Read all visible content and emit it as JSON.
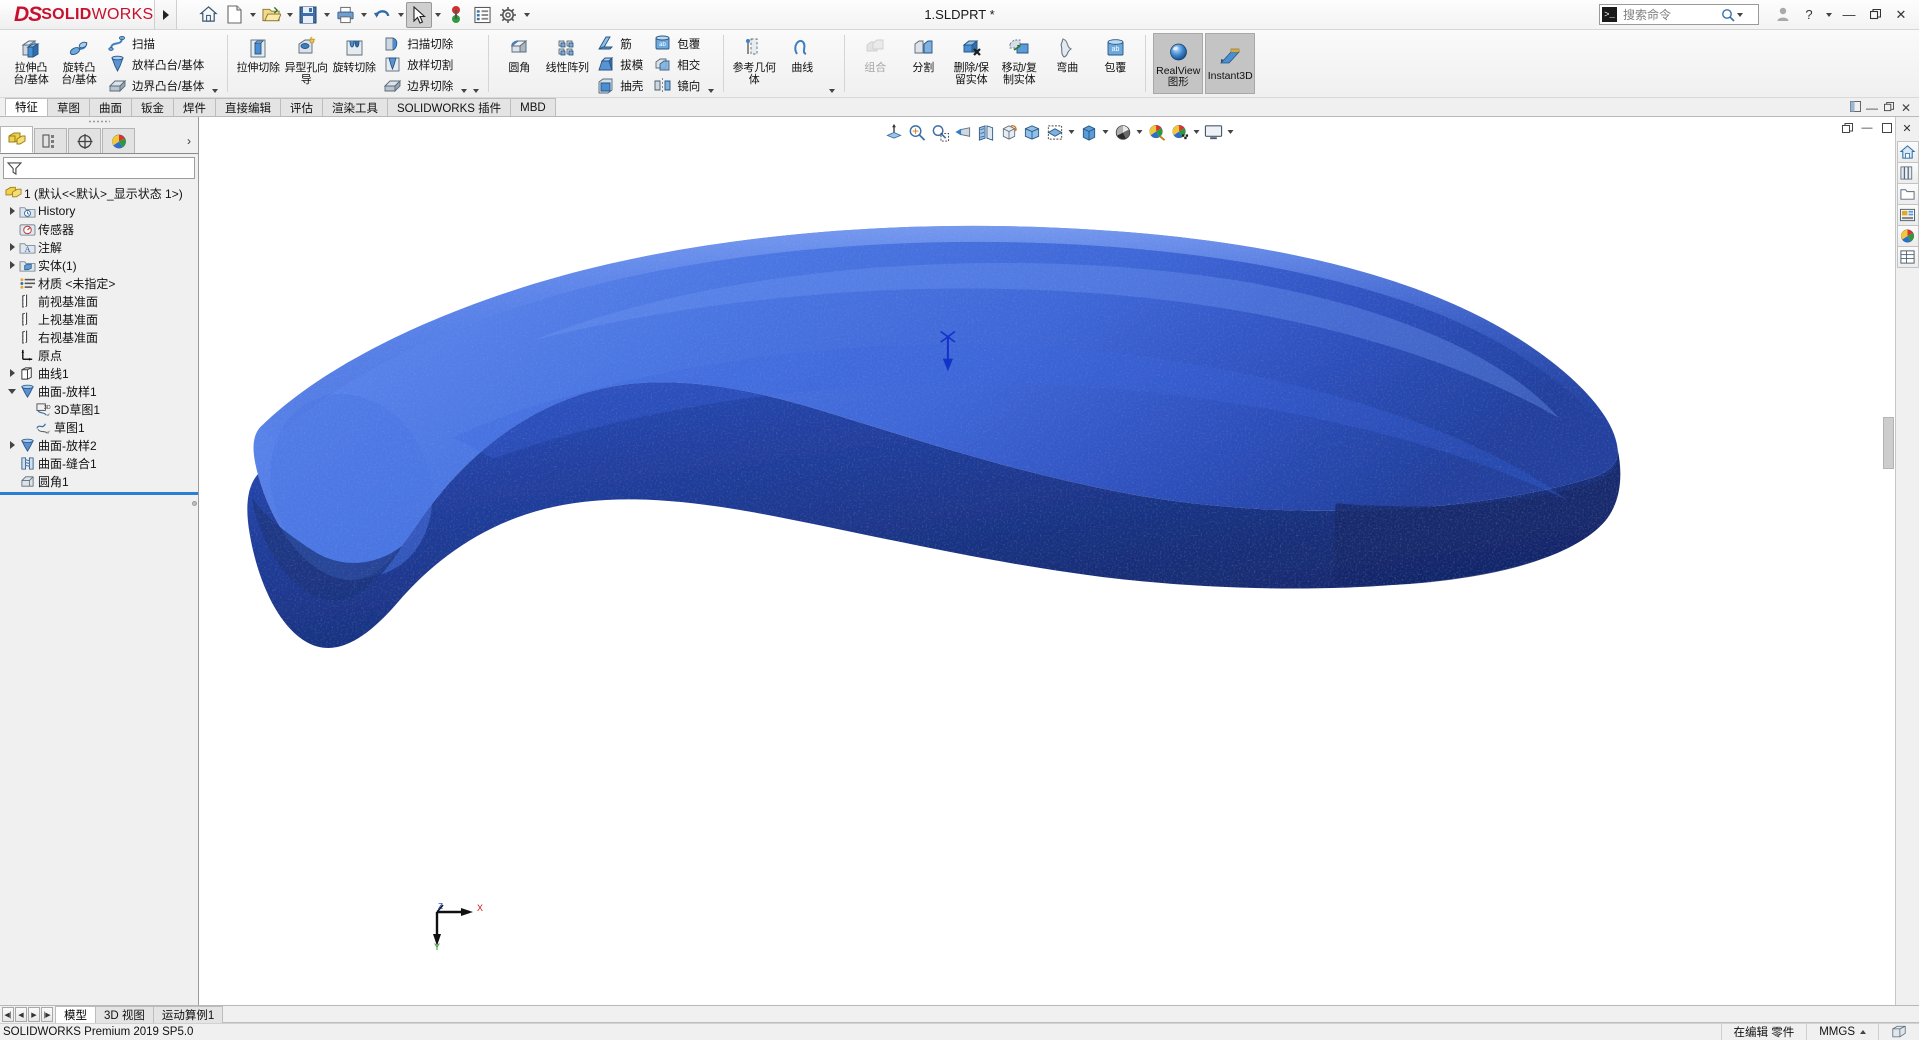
{
  "app": {
    "brand_ds": "DS",
    "brand_solid": "SOLID",
    "brand_works": "WORKS",
    "window_title": "1.SLDPRT *",
    "accent_color": "#c8102e",
    "model_color": "#3a62d8"
  },
  "titlebar": {
    "tools": [
      {
        "name": "home-icon",
        "label": "主页"
      },
      {
        "name": "new-document-icon",
        "label": "新建"
      },
      {
        "name": "open-folder-icon",
        "label": "打开"
      },
      {
        "name": "save-icon",
        "label": "保存"
      },
      {
        "name": "print-icon",
        "label": "打印"
      },
      {
        "name": "undo-icon",
        "label": "撤销"
      },
      {
        "name": "select-cursor-icon",
        "label": "选择"
      },
      {
        "name": "rebuild-icon",
        "label": "重建模型"
      },
      {
        "name": "options-list-icon",
        "label": "文件属性"
      },
      {
        "name": "gear-icon",
        "label": "选项"
      }
    ],
    "search": {
      "placeholder": "搜索命令",
      "value": ""
    },
    "user_label": "用户",
    "help_label": "?",
    "minimize": "—",
    "restore": "❐",
    "close": "✕"
  },
  "ribbon": {
    "groups": [
      {
        "name": "boss-base-group",
        "big": [
          {
            "label": "拉伸凸台/基体",
            "icon": "extrude-boss-icon"
          },
          {
            "label": "旋转凸台/基体",
            "icon": "revolve-boss-icon"
          }
        ],
        "small": [
          {
            "label": "扫描",
            "icon": "sweep-icon"
          },
          {
            "label": "放样凸台/基体",
            "icon": "loft-boss-icon"
          },
          {
            "label": "边界凸台/基体",
            "icon": "boundary-boss-icon"
          }
        ]
      },
      {
        "name": "cut-group",
        "big": [
          {
            "label": "拉伸切除",
            "icon": "extrude-cut-icon"
          },
          {
            "label": "异型孔向导",
            "icon": "hole-wizard-icon"
          },
          {
            "label": "旋转切除",
            "icon": "revolve-cut-icon"
          }
        ],
        "small": [
          {
            "label": "扫描切除",
            "icon": "sweep-cut-icon"
          },
          {
            "label": "放样切割",
            "icon": "loft-cut-icon"
          },
          {
            "label": "边界切除",
            "icon": "boundary-cut-icon"
          }
        ]
      },
      {
        "name": "feature-group",
        "big": [
          {
            "label": "圆角",
            "icon": "fillet-icon"
          },
          {
            "label": "线性阵列",
            "icon": "linear-pattern-icon"
          }
        ],
        "small": [
          {
            "label": "筋",
            "icon": "rib-icon"
          },
          {
            "label": "拔模",
            "icon": "draft-icon"
          },
          {
            "label": "抽壳",
            "icon": "shell-icon"
          },
          {
            "label": "包覆",
            "icon": "wrap-icon"
          },
          {
            "label": "相交",
            "icon": "intersect-icon"
          },
          {
            "label": "镜向",
            "icon": "mirror-icon"
          }
        ]
      },
      {
        "name": "reference-group",
        "big": [
          {
            "label": "参考几何体",
            "icon": "reference-geometry-icon"
          },
          {
            "label": "曲线",
            "icon": "curves-icon"
          }
        ]
      },
      {
        "name": "body-group",
        "big": [
          {
            "label": "组合",
            "icon": "combine-icon",
            "disabled": true
          },
          {
            "label": "分割",
            "icon": "split-icon"
          },
          {
            "label": "删除/保留实体",
            "icon": "delete-keep-body-icon"
          },
          {
            "label": "移动/复制实体",
            "icon": "move-copy-body-icon"
          },
          {
            "label": "弯曲",
            "icon": "flex-icon"
          },
          {
            "label": "包覆",
            "icon": "wrap-body-icon"
          }
        ]
      }
    ],
    "toggles": [
      {
        "label": "RealView 图形",
        "line1": "RealView",
        "line2": "图形",
        "icon": "realview-sphere-icon",
        "active": true
      },
      {
        "label": "Instant3D",
        "line1": "Instant3D",
        "line2": "",
        "icon": "instant3d-icon",
        "active": true
      }
    ]
  },
  "tabs": {
    "items": [
      {
        "label": "特征",
        "active": true
      },
      {
        "label": "草图",
        "active": false
      },
      {
        "label": "曲面",
        "active": false
      },
      {
        "label": "钣金",
        "active": false
      },
      {
        "label": "焊件",
        "active": false
      },
      {
        "label": "直接编辑",
        "active": false
      },
      {
        "label": "评估",
        "active": false
      },
      {
        "label": "渲染工具",
        "active": false
      },
      {
        "label": "SOLIDWORKS 插件",
        "active": false
      },
      {
        "label": "MBD",
        "active": false
      }
    ],
    "right_controls": [
      "pin-icon",
      "minimize-icon",
      "restore-icon",
      "close-icon"
    ]
  },
  "left_panel": {
    "tabs": [
      {
        "name": "feature-manager-tab",
        "icon": "feature-tree-icon",
        "active": true
      },
      {
        "name": "property-manager-tab",
        "icon": "property-manager-icon",
        "active": false
      },
      {
        "name": "configuration-manager-tab",
        "icon": "configuration-icon",
        "active": false
      },
      {
        "name": "display-manager-tab",
        "icon": "display-manager-icon",
        "active": false
      }
    ],
    "filter_placeholder": "",
    "tree": [
      {
        "label": "1  (默认<<默认>_显示状态 1>)",
        "icon": "part-icon",
        "indent": 0,
        "arrow": "none"
      },
      {
        "label": "History",
        "icon": "history-icon",
        "indent": 1,
        "arrow": "right"
      },
      {
        "label": "传感器",
        "icon": "sensor-icon",
        "indent": 1,
        "arrow": "none"
      },
      {
        "label": "注解",
        "icon": "annotations-icon",
        "indent": 1,
        "arrow": "right"
      },
      {
        "label": "实体(1)",
        "icon": "solid-bodies-icon",
        "indent": 1,
        "arrow": "right"
      },
      {
        "label": "材质 <未指定>",
        "icon": "material-icon",
        "indent": 1,
        "arrow": "none"
      },
      {
        "label": "前视基准面",
        "icon": "plane-icon",
        "indent": 1,
        "arrow": "none"
      },
      {
        "label": "上视基准面",
        "icon": "plane-icon",
        "indent": 1,
        "arrow": "none"
      },
      {
        "label": "右视基准面",
        "icon": "plane-icon",
        "indent": 1,
        "arrow": "none"
      },
      {
        "label": "原点",
        "icon": "origin-icon",
        "indent": 1,
        "arrow": "none"
      },
      {
        "label": "曲线1",
        "icon": "curve-icon",
        "indent": 1,
        "arrow": "right"
      },
      {
        "label": "曲面-放样1",
        "icon": "surface-loft-icon",
        "indent": 1,
        "arrow": "down"
      },
      {
        "label": "3D草图1",
        "icon": "sketch3d-icon",
        "indent": 2,
        "arrow": "none"
      },
      {
        "label": "草图1",
        "icon": "sketch-icon",
        "indent": 2,
        "arrow": "none"
      },
      {
        "label": "曲面-放样2",
        "icon": "surface-loft-icon",
        "indent": 1,
        "arrow": "right"
      },
      {
        "label": "曲面-缝合1",
        "icon": "surface-knit-icon",
        "indent": 1,
        "arrow": "none"
      },
      {
        "label": "圆角1",
        "icon": "fillet-icon",
        "indent": 1,
        "arrow": "none"
      }
    ]
  },
  "viewport": {
    "toolbar": [
      {
        "name": "section-view-icon",
        "caret": false
      },
      {
        "name": "zoom-to-fit-icon",
        "caret": false
      },
      {
        "name": "zoom-to-area-icon",
        "caret": false
      },
      {
        "name": "previous-view-icon",
        "caret": false
      },
      {
        "name": "section-cut-icon",
        "caret": false
      },
      {
        "name": "view-orientation-icon",
        "caret": false
      },
      {
        "name": "view-cube-icon",
        "caret": false
      },
      {
        "name": "display-style-icon",
        "caret": true
      },
      {
        "name": "hide-show-items-icon",
        "caret": true
      },
      {
        "name": "edit-appearance-icon",
        "caret": true
      },
      {
        "name": "apply-scene-icon",
        "caret": true
      },
      {
        "name": "view-settings-icon",
        "caret": true
      },
      {
        "name": "viewport-layout-icon",
        "caret": true
      }
    ],
    "window_buttons": [
      "restore-icon",
      "minimize-icon",
      "maximize-icon",
      "close-icon"
    ],
    "triad": {
      "x_label": "X",
      "y_label": "Y",
      "z_label": "Z"
    }
  },
  "task_pane": [
    {
      "name": "home-tab-icon"
    },
    {
      "name": "design-library-icon"
    },
    {
      "name": "file-explorer-icon"
    },
    {
      "name": "view-palette-icon"
    },
    {
      "name": "appearances-scenes-icon"
    },
    {
      "name": "custom-properties-icon"
    }
  ],
  "bottom": {
    "nav": [
      "first",
      "prev",
      "next",
      "last"
    ],
    "tabs": [
      {
        "label": "模型",
        "active": true
      },
      {
        "label": "3D 视图",
        "active": false
      },
      {
        "label": "运动算例1",
        "active": false
      }
    ]
  },
  "status": {
    "left": "SOLIDWORKS Premium 2019 SP5.0",
    "editing": "在编辑 零件",
    "units": "MMGS"
  }
}
